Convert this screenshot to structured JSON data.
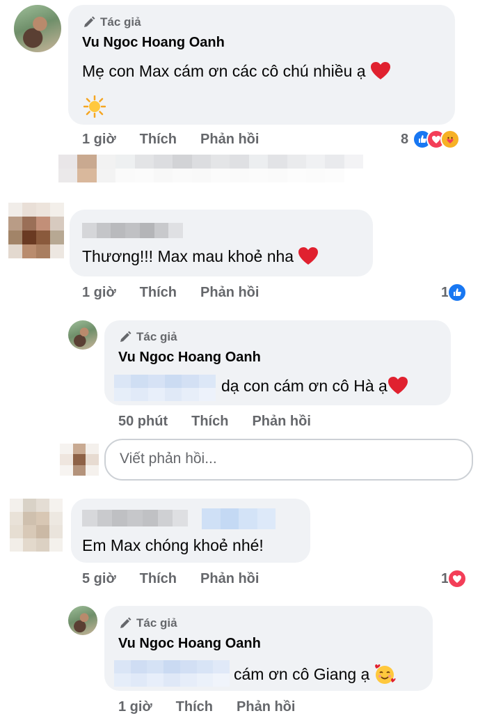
{
  "comments": [
    {
      "author_tag": "Tác giả",
      "author": "Vu Ngoc Hoang Oanh",
      "text": "Mẹ con Max cám ơn các cô chú nhiều ạ",
      "time": "1 giờ",
      "like_label": "Thích",
      "reply_label": "Phản hồi",
      "reaction_count": "8"
    },
    {
      "text": "Thương!!! Max mau khoẻ nha",
      "time": "1 giờ",
      "like_label": "Thích",
      "reply_label": "Phản hồi",
      "reaction_count": "1"
    },
    {
      "author_tag": "Tác giả",
      "author": "Vu Ngoc Hoang Oanh",
      "text": "dạ con cám ơn cô Hà ạ",
      "time": "50 phút",
      "like_label": "Thích",
      "reply_label": "Phản hồi"
    },
    {
      "text": "Em Max chóng khoẻ nhé!",
      "time": "5 giờ",
      "like_label": "Thích",
      "reply_label": "Phản hồi",
      "reaction_count": "1"
    },
    {
      "author_tag": "Tác giả",
      "author": "Vu Ngoc Hoang Oanh",
      "text": "cám ơn cô Giang ạ",
      "time": "1 giờ",
      "like_label": "Thích",
      "reply_label": "Phản hồi"
    }
  ],
  "reply_box": {
    "placeholder": "Viết phản hồi..."
  },
  "icons": {
    "author": "pencil-icon",
    "heart": "red-heart-emoji",
    "sun": "sun-emoji",
    "like": "like-reaction-icon",
    "love": "love-reaction-icon",
    "care": "care-reaction-icon",
    "hug_face": "smiling-face-with-hearts-emoji"
  },
  "colors": {
    "bubble": "#f0f2f5",
    "meta_text": "#65676b",
    "like_blue": "#1877f2",
    "love_red": "#f33e58"
  }
}
